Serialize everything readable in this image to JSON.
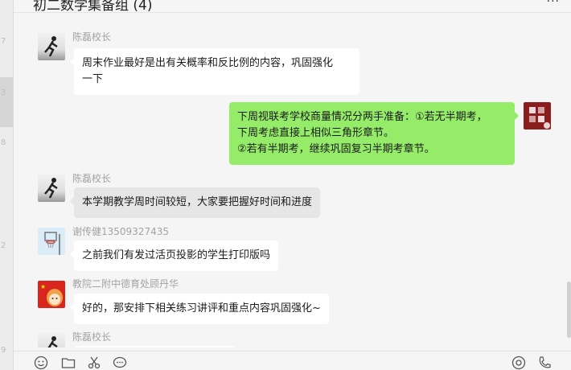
{
  "window": {
    "title": "初二数学集备组 (4)",
    "more_icon": "more-icon",
    "left_strip_fragments": [
      "7",
      "3",
      "8",
      "2",
      "9"
    ]
  },
  "messages": [
    {
      "sender": "陈磊校长",
      "direction": "incoming",
      "avatar_icon": "runner-avatar-icon",
      "lines": [
        "周末作业最好是出有关概率和反比例的内容，巩固强化",
        "一下"
      ]
    },
    {
      "sender": "",
      "direction": "outgoing",
      "avatar_icon": "seal-avatar-icon",
      "lines": [
        "下周视联考学校商量情况分两手准备：①若无半期考，",
        "下周考虑直接上相似三角形章节。",
        "②若有半期考，继续巩固复习半期考章节。"
      ]
    },
    {
      "sender": "陈磊校长",
      "direction": "incoming",
      "avatar_icon": "runner-avatar-icon",
      "lines": [
        "本学期教学周时间较短，大家要把握好时间和进度"
      ]
    },
    {
      "sender": "谢传健13509327435",
      "direction": "incoming",
      "avatar_icon": "basketball-hoop-avatar-icon",
      "lines": [
        "之前我们有发过活页投影的学生打印版吗"
      ]
    },
    {
      "sender": "教院二附中德育处顾丹华",
      "direction": "incoming",
      "avatar_icon": "flag-girl-avatar-icon",
      "lines": [
        "好的，那安排下相关练习讲评和重点内容巩固强化~"
      ]
    },
    {
      "sender": "陈磊校长",
      "direction": "incoming",
      "avatar_icon": "runner-avatar-icon",
      "lines": []
    }
  ],
  "toolbar": {
    "icons": [
      "emoji-icon",
      "folder-icon",
      "scissors-icon",
      "chat-bubble-icon",
      "video-call-icon",
      "phone-icon"
    ]
  },
  "colors": {
    "outgoing_bubble": "#95ec69",
    "incoming_bubble": "#ffffff",
    "background": "#f5f5f5"
  }
}
